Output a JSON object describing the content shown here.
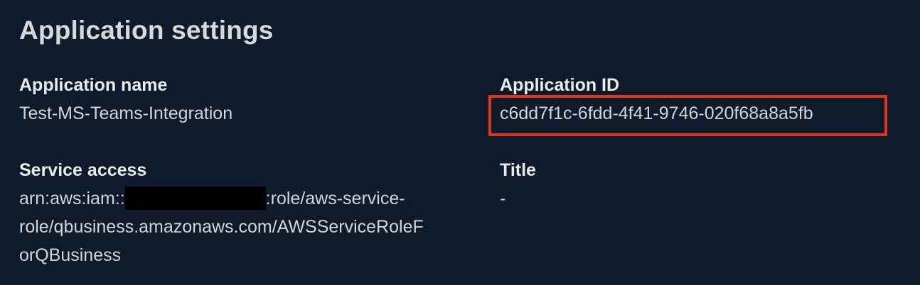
{
  "section": {
    "title": "Application settings"
  },
  "fields": {
    "application_name": {
      "label": "Application name",
      "value": "Test-MS-Teams-Integration"
    },
    "application_id": {
      "label": "Application ID",
      "value": "c6dd7f1c-6fdd-4f41-9746-020f68a8a5fb"
    },
    "service_access": {
      "label": "Service access",
      "value_prefix": "arn:aws:iam::",
      "value_suffix_line1": ":role/aws-service-",
      "value_line2": "role/qbusiness.amazonaws.com/AWSServiceRoleF",
      "value_line3": "orQBusiness"
    },
    "title": {
      "label": "Title",
      "value": "-"
    }
  },
  "colors": {
    "background": "#0f1b2a",
    "label": "#e9ebed",
    "value": "#d1d5db",
    "highlight": "#e0341f",
    "redaction": "#000000"
  }
}
